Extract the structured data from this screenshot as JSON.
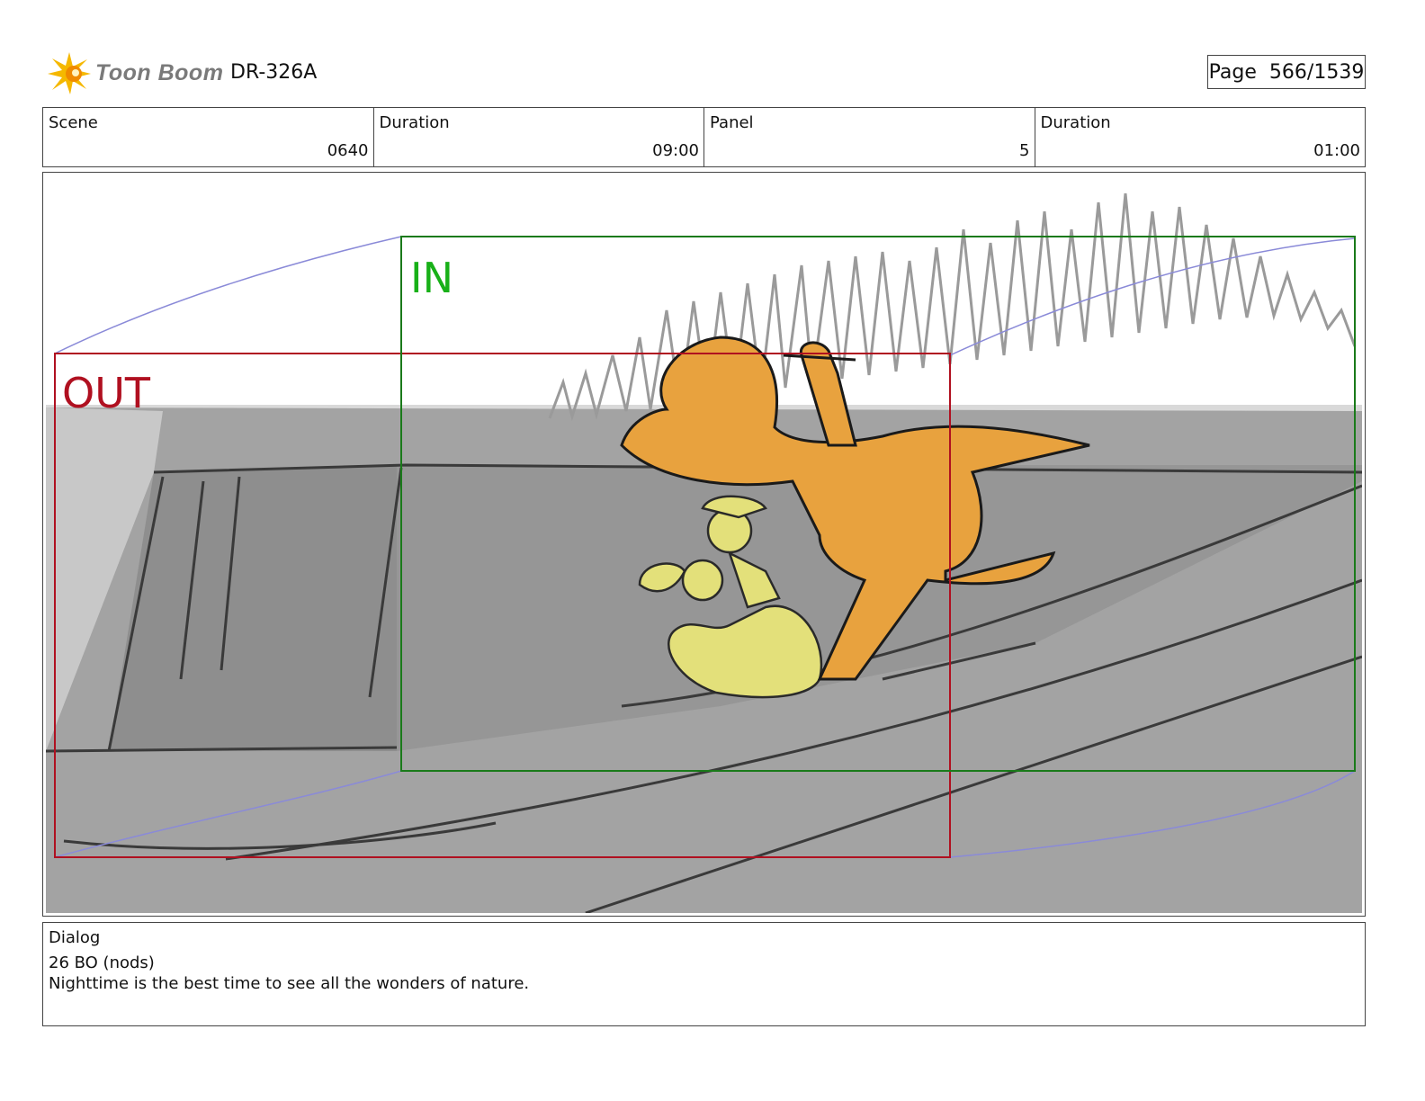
{
  "header": {
    "logo_text": "Toon Boom",
    "doc_id": "DR-326A",
    "page_label": "Page",
    "page_value": "566/1539"
  },
  "info": {
    "scene_label": "Scene",
    "scene_value": "0640",
    "scene_duration_label": "Duration",
    "scene_duration_value": "09:00",
    "panel_label": "Panel",
    "panel_value": "5",
    "panel_duration_label": "Duration",
    "panel_duration_value": "01:00"
  },
  "panel": {
    "in_label": "IN",
    "out_label": "OUT",
    "colors": {
      "in_frame": "#1a7a1a",
      "out_frame": "#b01020",
      "dino": "#e8a23e",
      "kids": "#e3e07a",
      "ground": "#9a9a9a",
      "camera_path": "#8a8ad8"
    }
  },
  "dialog": {
    "label": "Dialog",
    "lines": [
      "26 BO (nods)",
      "Nighttime is the best time to see all the wonders of nature."
    ]
  }
}
